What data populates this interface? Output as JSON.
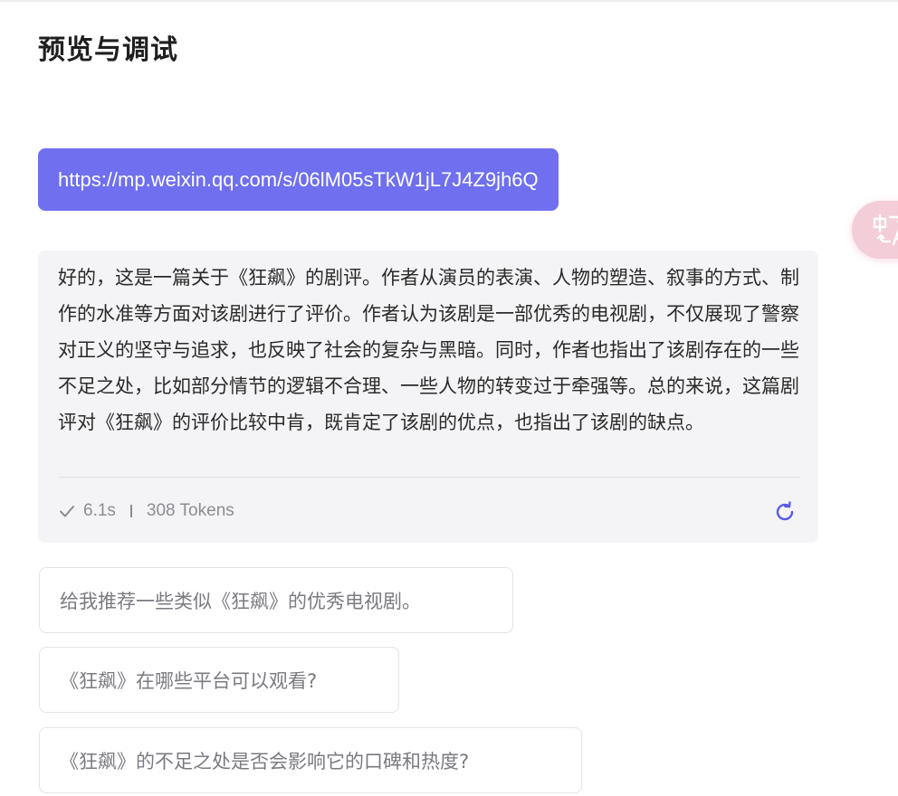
{
  "header": {
    "title": "预览与调试"
  },
  "conversation": {
    "user_message": "https://mp.weixin.qq.com/s/06lM05sTkW1jL7J4Z9jh6Q",
    "ai_reply": {
      "text": "好的，这是一篇关于《狂飙》的剧评。作者从演员的表演、人物的塑造、叙事的方式、制作的水准等方面对该剧进行了评价。作者认为该剧是一部优秀的电视剧，不仅展现了警察对正义的坚守与追求，也反映了社会的复杂与黑暗。同时，作者也指出了该剧存在的一些不足之处，比如部分情节的逻辑不合理、一些人物的转变过于牵强等。总的来说，这篇剧评对《狂飙》的评价比较中肯，既肯定了该剧的优点，也指出了该剧的缺点。",
      "duration": "6.1s",
      "tokens": "308 Tokens",
      "status_icon": "check-icon",
      "action_icon": "refresh-icon"
    }
  },
  "suggestions": [
    {
      "label": "给我推荐一些类似《狂飙》的优秀电视剧。"
    },
    {
      "label": "《狂飙》在哪些平台可以观看?"
    },
    {
      "label": "《狂飙》的不足之处是否会影响它的口碑和热度?"
    }
  ],
  "floating": {
    "icon": "translate-icon"
  },
  "colors": {
    "accent": "#6f6ff0",
    "refresh_icon": "#5a5ae8",
    "bubble_bg": "#f4f4f6",
    "floating_bg": "#f3cdd8"
  }
}
